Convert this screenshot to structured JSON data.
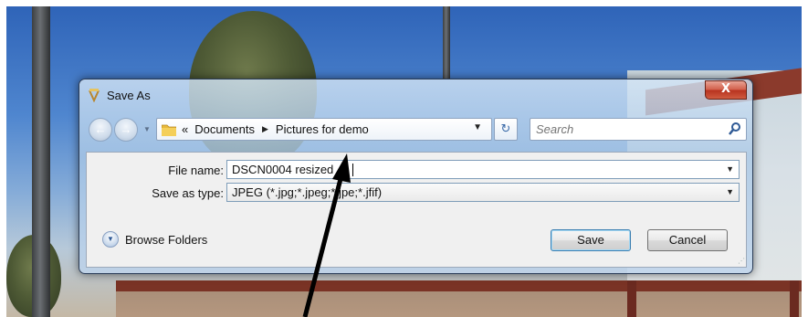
{
  "dialog": {
    "title": "Save As",
    "close_glyph": "X",
    "icon": "save-as-icon"
  },
  "nav": {
    "back_glyph": "←",
    "forward_glyph": "→",
    "overflow": "«",
    "crumbs": [
      "Documents",
      "Pictures for demo"
    ],
    "crumb_arrow": "▶",
    "dropdown_glyph": "▼",
    "refresh_glyph": "↻",
    "search_placeholder": "Search"
  },
  "form": {
    "file_name_label": "File name:",
    "file_name_value": "DSCN0004 resized",
    "save_type_label": "Save as type:",
    "save_type_value": "JPEG (*.jpg;*.jpeg;*.jpe;*.jfif)"
  },
  "footer": {
    "browse_label": "Browse Folders",
    "save_label": "Save",
    "cancel_label": "Cancel"
  },
  "colors": {
    "close_red": "#c8412b",
    "default_button_border": "#3c7fb1",
    "annotation_arrow": "#000000"
  }
}
